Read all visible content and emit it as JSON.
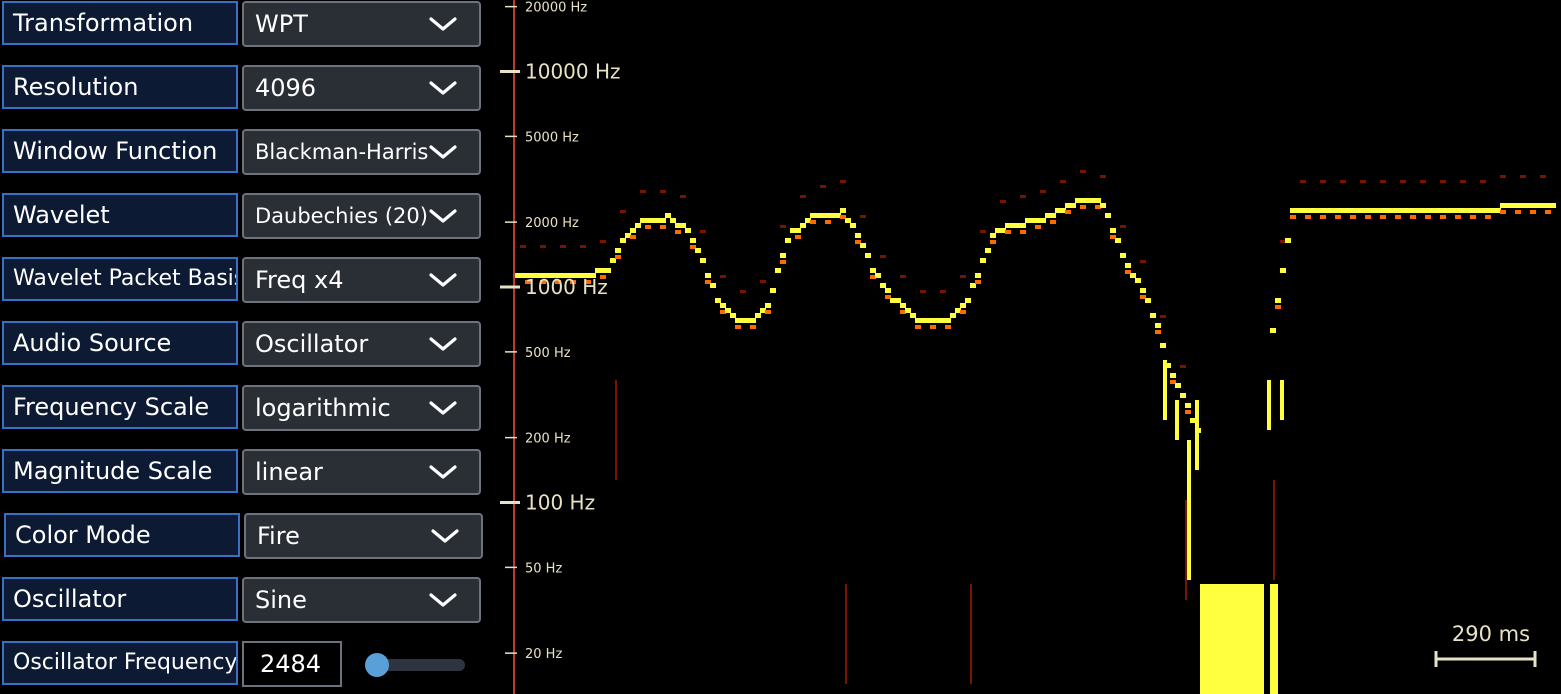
{
  "controls": [
    {
      "label": "Transformation",
      "value": "WPT"
    },
    {
      "label": "Resolution",
      "value": "4096"
    },
    {
      "label": "Window Function",
      "value": "Blackman-Harris"
    },
    {
      "label": "Wavelet",
      "value": "Daubechies (20)"
    },
    {
      "label": "Wavelet Packet Basis",
      "value": "Freq x4"
    },
    {
      "label": "Audio Source",
      "value": "Oscillator"
    },
    {
      "label": "Frequency Scale",
      "value": "logarithmic"
    },
    {
      "label": "Magnitude Scale",
      "value": "linear"
    },
    {
      "label": "Color Mode",
      "value": "Fire"
    },
    {
      "label": "Oscillator",
      "value": "Sine"
    }
  ],
  "oscillator_frequency": {
    "label": "Oscillator Frequency",
    "value": "2484",
    "slider_fraction": 0.02
  },
  "spectrogram": {
    "frequency_ticks": [
      {
        "hz": 20000,
        "label": "20000 Hz",
        "major": false
      },
      {
        "hz": 10000,
        "label": "10000 Hz",
        "major": true
      },
      {
        "hz": 5000,
        "label": "5000 Hz",
        "major": false
      },
      {
        "hz": 2000,
        "label": "2000 Hz",
        "major": false
      },
      {
        "hz": 1000,
        "label": "1000 Hz",
        "major": true
      },
      {
        "hz": 500,
        "label": "500 Hz",
        "major": false
      },
      {
        "hz": 200,
        "label": "200 Hz",
        "major": false
      },
      {
        "hz": 100,
        "label": "100 Hz",
        "major": true
      },
      {
        "hz": 50,
        "label": "50 Hz",
        "major": false
      },
      {
        "hz": 20,
        "label": "20 Hz",
        "major": false
      }
    ],
    "time_scale_label": "290 ms",
    "colors": {
      "axis": "#c0392b",
      "tick": "#e8e2c4",
      "hot": "#ffff40",
      "warm": "#ff6a00",
      "dim": "#7a1400"
    }
  }
}
